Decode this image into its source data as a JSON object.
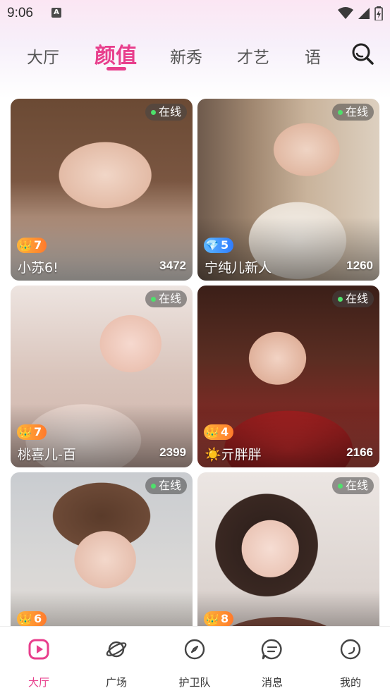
{
  "status_bar": {
    "time": "9:06",
    "notification_icon": "A"
  },
  "tabs": [
    {
      "label": "大厅",
      "active": false
    },
    {
      "label": "颜值",
      "active": true
    },
    {
      "label": "新秀",
      "active": false
    },
    {
      "label": "才艺",
      "active": false
    },
    {
      "label": "语",
      "active": false
    }
  ],
  "cards": [
    {
      "status": "在线",
      "level": "7",
      "badge": "crown",
      "name": "小苏6!",
      "count": "3472"
    },
    {
      "status": "在线",
      "level": "5",
      "badge": "diamond",
      "name": "宁纯儿新人",
      "count": "1260"
    },
    {
      "status": "在线",
      "level": "7",
      "badge": "crown",
      "name": "桃喜儿-百",
      "count": "2399"
    },
    {
      "status": "在线",
      "level": "4",
      "badge": "crown",
      "name": "☀️亓胖胖",
      "count": "2166"
    },
    {
      "status": "在线",
      "level": "6",
      "badge": "crown",
      "name": "",
      "count": ""
    },
    {
      "status": "在线",
      "level": "8",
      "badge": "crown",
      "name": "",
      "count": ""
    }
  ],
  "bottom_nav": [
    {
      "label": "大厅",
      "icon": "play-icon",
      "active": true
    },
    {
      "label": "广场",
      "icon": "planet-icon",
      "active": false
    },
    {
      "label": "护卫队",
      "icon": "compass-icon",
      "active": false
    },
    {
      "label": "消息",
      "icon": "message-icon",
      "active": false
    },
    {
      "label": "我的",
      "icon": "profile-icon",
      "active": false
    }
  ],
  "colors": {
    "accent": "#e83e8c",
    "online_dot": "#4ee06b",
    "crown_badge": "#ff9a33",
    "diamond_badge": "#3d8bff"
  }
}
